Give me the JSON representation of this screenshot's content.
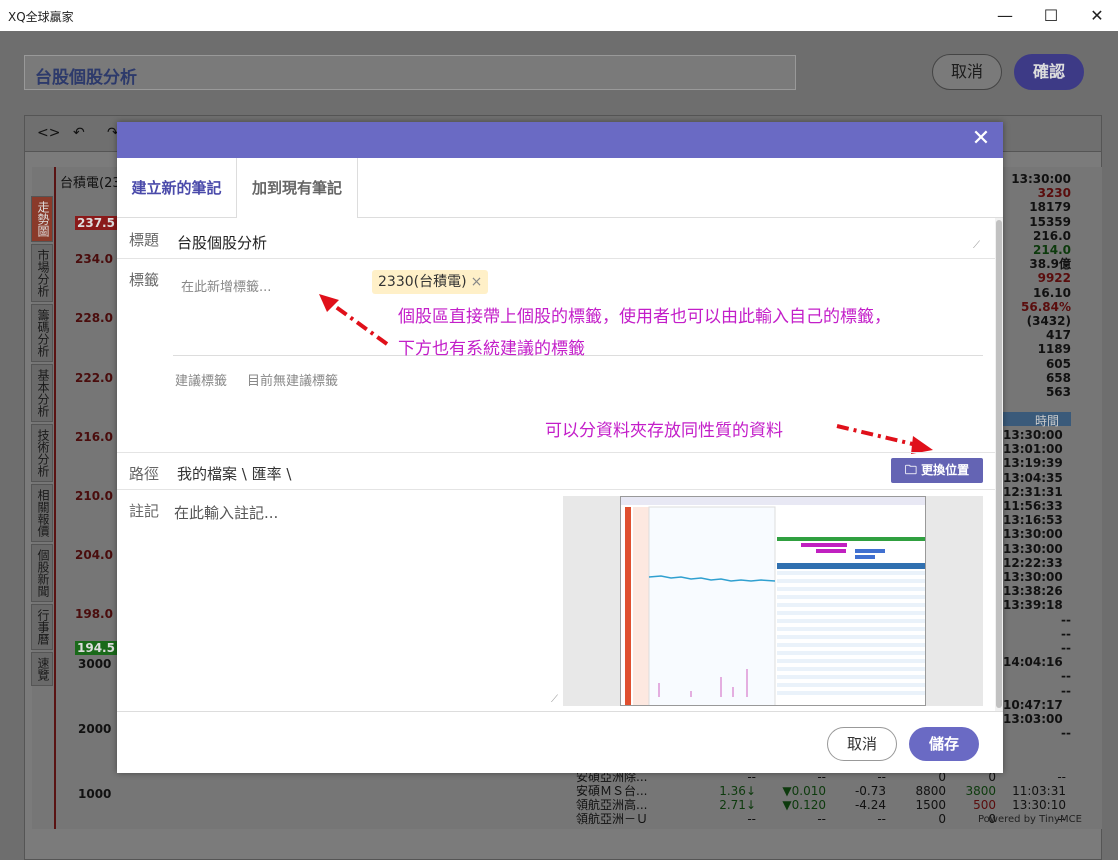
{
  "window": {
    "title": "XQ全球贏家",
    "minimize_glyph": "—",
    "maximize_glyph": "☐",
    "close_glyph": "✕"
  },
  "page": {
    "note_title": "台股個股分析",
    "cancel_label": "取消",
    "confirm_label": "確認"
  },
  "editor": {
    "toolbar": [
      "<>",
      "↶",
      "↷"
    ]
  },
  "background": {
    "stock_name": "台積電(23",
    "side_tabs": [
      "走勢圖",
      "市場分析",
      "籌碼分析",
      "基本分析",
      "技術分析",
      "相關報價",
      "個股新聞",
      "行事曆",
      "速覽"
    ],
    "price_labels": [
      "237.5",
      "234.0",
      "228.0",
      "222.0",
      "216.0",
      "210.0",
      "204.0",
      "198.0",
      "194.5"
    ],
    "volume_labels": [
      "3000",
      "2000",
      "1000"
    ],
    "right_values": [
      "13:30:00",
      "3230",
      "18179",
      "15359",
      "216.0",
      "214.0",
      "38.9億",
      "9922",
      "16.10",
      "56.84%",
      "(3432)",
      "417",
      "1189",
      "605",
      "658",
      "563"
    ],
    "time_header": "時間",
    "times": [
      "13:30:00",
      "13:01:00",
      "13:19:39",
      "13:04:35",
      "12:31:31",
      "11:56:33",
      "13:16:53",
      "13:30:00",
      "13:30:00",
      "12:22:33",
      "13:30:00",
      "",
      "13:38:26",
      "13:39:18",
      "--",
      "--",
      "--",
      "14:04:16",
      "--",
      "--",
      "10:47:17",
      "13:03:00",
      "--"
    ],
    "bottom_rows": [
      {
        "name": "安碩亞洲除...",
        "c1": "--",
        "c2": "--",
        "c3": "--",
        "c4": "0",
        "c5": "0",
        "c6": "--"
      },
      {
        "name": "安碩ＭＳ台...",
        "c1": "1.36↓",
        "c2": "▼0.010",
        "c3": "-0.73",
        "c4": "8800",
        "c5": "3800",
        "c6": "11:03:31"
      },
      {
        "name": "領航亞洲高...",
        "c1": "2.71↓",
        "c2": "▼0.120",
        "c3": "-4.24",
        "c4": "1500",
        "c5": "500",
        "c6": "13:30:10"
      },
      {
        "name": "領航亞洲－Ｕ",
        "c1": "--",
        "c2": "--",
        "c3": "--",
        "c4": "0",
        "c5": "0",
        "c6": "--"
      }
    ],
    "powered_by": "Powered by TinyMCE"
  },
  "modal": {
    "close_glyph": "✕",
    "tabs": [
      "建立新的筆記",
      "加到現有筆記"
    ],
    "title_label": "標題",
    "title_value": "台股個股分析",
    "tags_label": "標籤",
    "tags_placeholder": "在此新增標籤...",
    "tag_chip": "2330(台積電)",
    "tag_remove_glyph": "×",
    "suggest_label": "建議標籤",
    "suggest_value": "目前無建議標籤",
    "path_label": "路徑",
    "path_value": "我的檔案 \\ 匯率 \\",
    "change_location_label": "更換位置",
    "notes_label": "註記",
    "notes_placeholder": "在此輸入註記...",
    "cancel_label": "取消",
    "save_label": "儲存"
  },
  "annotations": {
    "tags_note_line1": "個股區直接帶上個股的標籤，使用者也可以由此輸入自己的標籤，",
    "tags_note_line2": "下方也有系統建議的標籤",
    "folder_note": "可以分資料夾存放同性質的資料"
  },
  "colors": {
    "modal_accent": "#6a6ac4",
    "annotation": "#c31ec9",
    "arrow": "#e0101a",
    "tag_chip_bg": "#fff0c8"
  }
}
